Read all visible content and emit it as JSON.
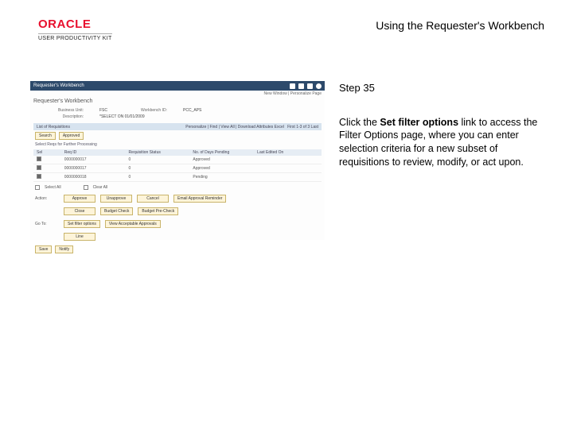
{
  "header": {
    "brand": "ORACLE",
    "product": "USER PRODUCTIVITY KIT",
    "doc_title": "Using the Requester's Workbench"
  },
  "instr": {
    "step": "Step 35",
    "p1a": "Click the ",
    "p1b": "Set filter options",
    "p1c": " link to access the Filter Options page, where you can enter selection criteria for a new subset of requisitions to review, modify, or act upon."
  },
  "shot": {
    "titlebar": "Requester's Workbench",
    "subline": "New Window | Personalize Page",
    "page_title": "Requester's Workbench",
    "f_business_unit_lbl": "Business Unit:",
    "f_business_unit_val": "FSC",
    "f_workbench_lbl": "Workbench ID:",
    "f_workbench_val": "PCC_APS",
    "f_description_lbl": "Description:",
    "f_description_val": "*SELECT ON 01/01/2009",
    "list_title": "List of Requisitions",
    "list_meta": "Personalize | Find | View All |",
    "download_link": "Download Attributes Excel",
    "first_label": "First",
    "last_label": "Last",
    "range": "1-3 of 3",
    "search_btn": "Search",
    "approved_btn": "Approved",
    "sel_label": "Select Reqs for Further Processing",
    "col_sel": "Sel",
    "col_req": "Req ID",
    "col_status": "Requisition Status",
    "col_days": "No. of Days Pending",
    "col_last": "Last Edited On",
    "row1_req": "0000000017",
    "row1_days": "0",
    "row1_status": "Approved",
    "row2_req": "0000000017",
    "row2_days": "0",
    "row2_status": "Approved",
    "row3_req": "0000000018",
    "row3_days": "0",
    "row3_status": "Pending",
    "selectall_lbl": "Select All",
    "clearall_lbl": "Clear All",
    "action_lbl": "Action:",
    "approve_btn": "Approve",
    "unapprove_btn": "Unapprove",
    "cancel_btn": "Cancel",
    "email_btn": "Email Approval Reminder",
    "close_btn": "Close",
    "budget_check_btn": "Budget Check",
    "budget_precheck_btn": "Budget Pre-Check",
    "goto_lbl": "Go To:",
    "setfilter_btn": "Set filter options",
    "viewappr_btn": "View Acceptable Approvals",
    "line_btn": "Line",
    "save_btn": "Save",
    "notify_btn": "Notify"
  }
}
